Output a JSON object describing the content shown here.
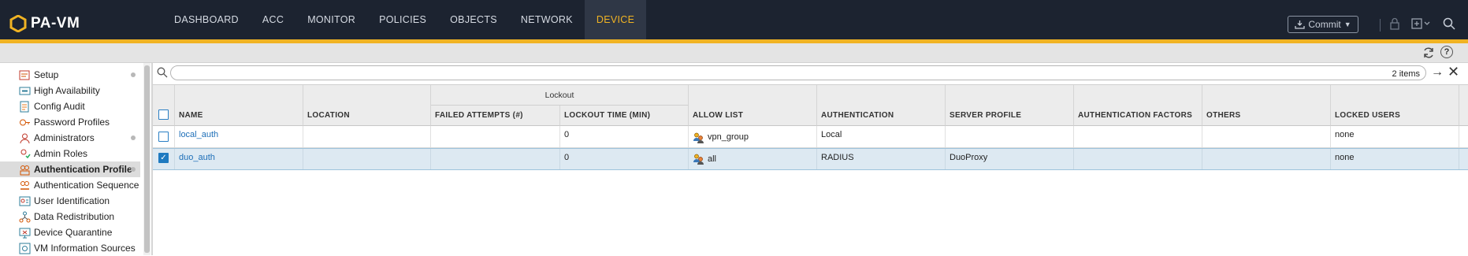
{
  "app": {
    "product_name": "PA-VM",
    "accent_color": "#f0b323",
    "nav_bg": "#1c2330"
  },
  "nav": {
    "tabs": [
      {
        "label": "DASHBOARD"
      },
      {
        "label": "ACC"
      },
      {
        "label": "MONITOR"
      },
      {
        "label": "POLICIES"
      },
      {
        "label": "OBJECTS"
      },
      {
        "label": "NETWORK"
      },
      {
        "label": "DEVICE",
        "active": true
      }
    ],
    "commit_label": "Commit",
    "icons": [
      "commit-icon",
      "lock-icon",
      "config-icon",
      "search-icon"
    ]
  },
  "subtoolbar": {
    "icons": [
      "refresh-icon",
      "help-icon"
    ]
  },
  "sidebar": {
    "items": [
      {
        "label": "Setup",
        "icon": "setup-icon",
        "dot": true
      },
      {
        "label": "High Availability",
        "icon": "ha-icon"
      },
      {
        "label": "Config Audit",
        "icon": "audit-icon"
      },
      {
        "label": "Password Profiles",
        "icon": "password-icon"
      },
      {
        "label": "Administrators",
        "icon": "admin-icon",
        "dot": true
      },
      {
        "label": "Admin Roles",
        "icon": "roles-icon"
      },
      {
        "label": "Authentication Profile",
        "icon": "auth-profile-icon",
        "dot": true,
        "selected": true
      },
      {
        "label": "Authentication Sequence",
        "icon": "auth-seq-icon"
      },
      {
        "label": "User Identification",
        "icon": "user-id-icon"
      },
      {
        "label": "Data Redistribution",
        "icon": "data-redist-icon"
      },
      {
        "label": "Device Quarantine",
        "icon": "quarantine-icon"
      },
      {
        "label": "VM Information Sources",
        "icon": "vm-icon"
      }
    ]
  },
  "filter": {
    "placeholder": "",
    "value": "",
    "items_count": "2 items"
  },
  "table": {
    "group_header": "Lockout",
    "columns": {
      "name": "NAME",
      "location": "LOCATION",
      "failed_attempts": "FAILED ATTEMPTS (#)",
      "lockout_time": "LOCKOUT TIME (MIN)",
      "allow_list": "ALLOW LIST",
      "authentication": "AUTHENTICATION",
      "server_profile": "SERVER PROFILE",
      "auth_factors": "AUTHENTICATION FACTORS",
      "others": "OTHERS",
      "locked_users": "LOCKED USERS"
    },
    "rows": [
      {
        "name": "local_auth",
        "location": "",
        "failed_attempts": "",
        "lockout_time": "0",
        "allow_list": "vpn_group",
        "authentication": "Local",
        "server_profile": "",
        "auth_factors": "",
        "others": "",
        "locked_users": "none",
        "checked": false
      },
      {
        "name": "duo_auth",
        "location": "",
        "failed_attempts": "",
        "lockout_time": "0",
        "allow_list": "all",
        "authentication": "RADIUS",
        "server_profile": "DuoProxy",
        "auth_factors": "",
        "others": "",
        "locked_users": "none",
        "checked": true
      }
    ]
  }
}
